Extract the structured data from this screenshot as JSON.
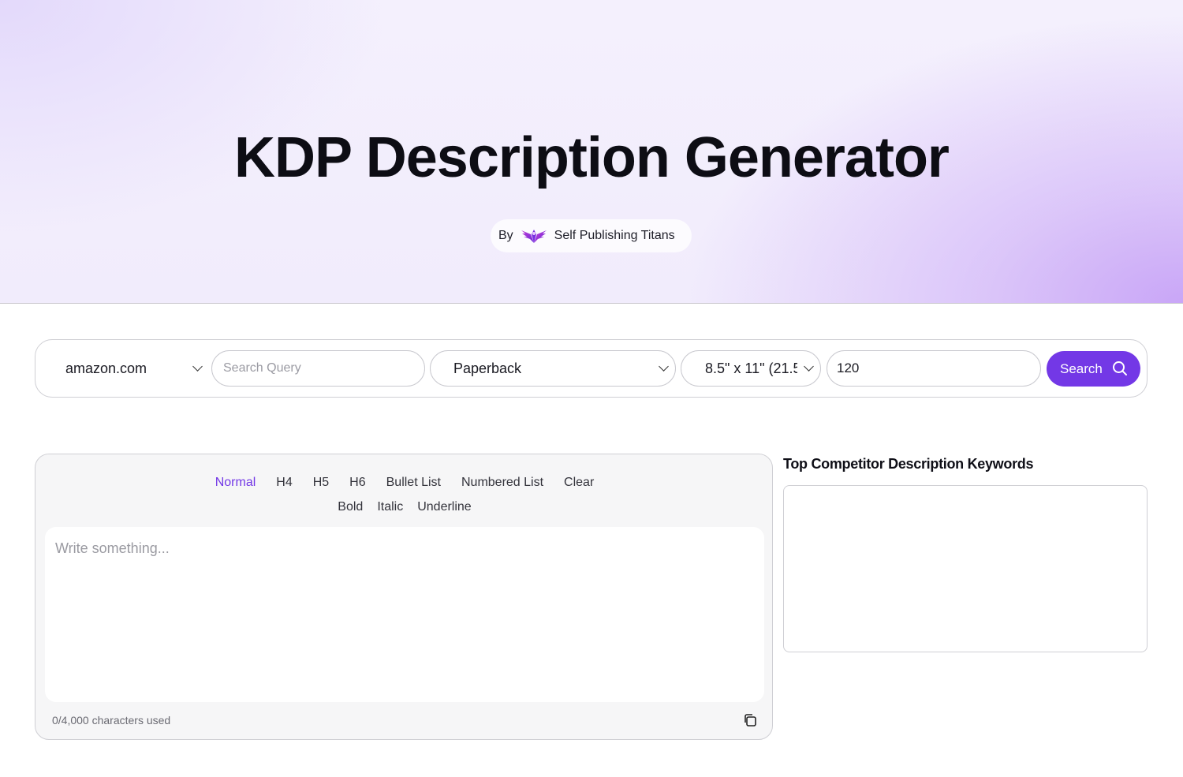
{
  "hero": {
    "title": "KDP Description Generator",
    "by_label": "By",
    "brand": "Self Publishing Titans",
    "brand_logo_icon": "winged-logo-icon",
    "accent_color": "#7338e6"
  },
  "search": {
    "marketplace": "amazon.com",
    "query_placeholder": "Search Query",
    "query_value": "",
    "format": "Paperback",
    "trim_size": "8.5\" x 11\" (21.5",
    "page_count": "120",
    "search_label": "Search"
  },
  "editor": {
    "toolbar_row1": [
      "Normal",
      "H4",
      "H5",
      "H6",
      "Bullet List",
      "Numbered List",
      "Clear"
    ],
    "toolbar_row2": [
      "Bold",
      "Italic",
      "Underline"
    ],
    "active_item": "Normal",
    "placeholder": "Write something...",
    "char_count": "0/4,000 characters used",
    "copy_icon": "copy-icon"
  },
  "keywords": {
    "title": "Top Competitor Description Keywords"
  }
}
